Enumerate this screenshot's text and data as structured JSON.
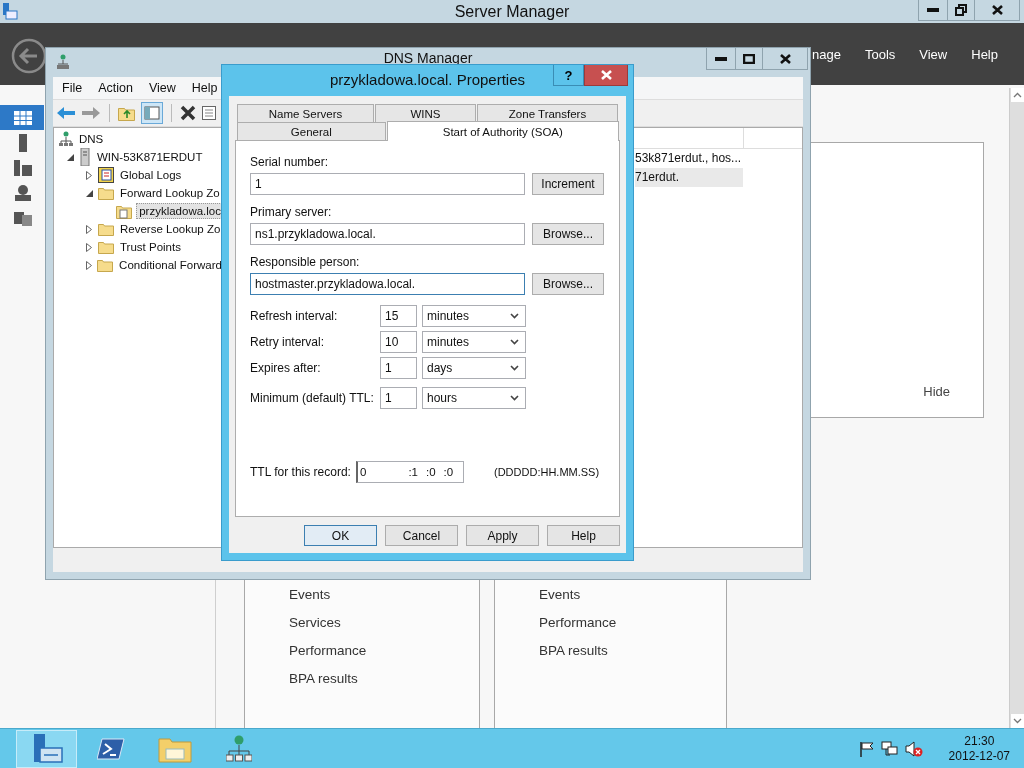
{
  "server_manager": {
    "title": "Server Manager",
    "menu": [
      "nage",
      "Tools",
      "View",
      "Help"
    ],
    "sidebar": [
      {
        "kind": "dashboard",
        "selected": true
      },
      {
        "kind": "server",
        "selected": false
      },
      {
        "kind": "servers",
        "selected": false
      },
      {
        "kind": "role",
        "selected": false
      },
      {
        "kind": "files",
        "selected": false
      }
    ],
    "hide_link": "Hide",
    "tiles": [
      {
        "items": [
          "Events",
          "Services",
          "Performance",
          "BPA results"
        ]
      },
      {
        "items": [
          "Events",
          "Performance",
          "BPA results"
        ]
      }
    ]
  },
  "dns_manager": {
    "title": "DNS Manager",
    "menu": [
      "File",
      "Action",
      "View",
      "Help"
    ],
    "tree": [
      {
        "label": "DNS",
        "kind": "dns",
        "selected": false,
        "children": [
          {
            "label": "WIN-53K871ERDUT",
            "kind": "server",
            "expanded": true,
            "selected": false,
            "children": [
              {
                "label": "Global Logs",
                "kind": "logs",
                "expanded": false,
                "selected": false
              },
              {
                "label": "Forward Lookup Zo",
                "kind": "folder",
                "expanded": true,
                "selected": false,
                "children": [
                  {
                    "label": "przykladowa.loc",
                    "kind": "zone",
                    "selected": true
                  }
                ]
              },
              {
                "label": "Reverse Lookup Zo",
                "kind": "folder",
                "expanded": false,
                "selected": false
              },
              {
                "label": "Trust Points",
                "kind": "folder",
                "expanded": false,
                "selected": false
              },
              {
                "label": "Conditional Forward",
                "kind": "folder",
                "expanded": false,
                "selected": false
              }
            ]
          }
        ]
      }
    ],
    "records": [
      {
        "data": "53k871erdut., hos...",
        "selected": false
      },
      {
        "data": "71erdut.",
        "selected": true
      }
    ]
  },
  "dialog": {
    "title": "przykladowa.local. Properties",
    "help_button": "?",
    "tab_rows": [
      [
        {
          "label": "Name Servers",
          "selected": false
        },
        {
          "label": "WINS",
          "selected": false
        },
        {
          "label": "Zone Transfers",
          "selected": false
        }
      ],
      [
        {
          "label": "General",
          "selected": false
        },
        {
          "label": "Start of Authority (SOA)",
          "selected": true
        }
      ]
    ],
    "fields": [
      {
        "label": "Serial number:",
        "value": "1",
        "button": "Increment",
        "focused": false
      },
      {
        "label": "Primary server:",
        "value": "ns1.przykladowa.local.",
        "button": "Browse...",
        "focused": false
      },
      {
        "label": "Responsible person:",
        "value": "hostmaster.przykladowa.local.",
        "button": "Browse...",
        "focused": true
      }
    ],
    "intervals": [
      {
        "label": "Refresh interval:",
        "value": "15",
        "unit": "minutes"
      },
      {
        "label": "Retry interval:",
        "value": "10",
        "unit": "minutes"
      },
      {
        "label": "Expires after:",
        "value": "1",
        "unit": "days"
      },
      {
        "label": "Minimum (default) TTL:",
        "value": "1",
        "unit": "hours"
      }
    ],
    "record_ttl": {
      "label": "TTL for this record:",
      "parts": [
        "0",
        ":1",
        ":0",
        ":0"
      ],
      "format": "(DDDDD:HH.MM.SS)"
    },
    "buttons": [
      {
        "label": "OK",
        "default": true
      },
      {
        "label": "Cancel",
        "default": false
      },
      {
        "label": "Apply",
        "default": false
      },
      {
        "label": "Help",
        "default": false
      }
    ]
  },
  "taskbar": {
    "apps": [
      {
        "kind": "server-manager",
        "active": true
      },
      {
        "kind": "powershell",
        "active": false
      },
      {
        "kind": "explorer",
        "active": false
      },
      {
        "kind": "dns",
        "active": false
      }
    ],
    "time": "21:30",
    "date": "2012-12-07"
  }
}
